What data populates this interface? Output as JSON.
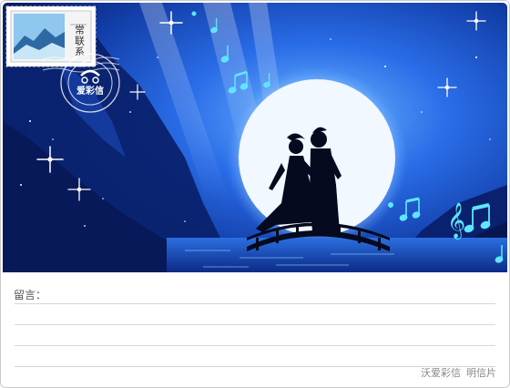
{
  "postcard": {
    "stamp": {
      "text": "常联系"
    },
    "postmark": {
      "brand": "爱彩信"
    }
  },
  "message": {
    "label": "留言："
  },
  "footer": {
    "brand": "沃爱彩信",
    "type": "明信片"
  },
  "colors": {
    "sky_dark": "#061a5c",
    "sky_mid": "#1a4fd1",
    "moon": "#eef6ff",
    "silhouette": "#050a1e",
    "music_notes": "#5fe6ff"
  }
}
